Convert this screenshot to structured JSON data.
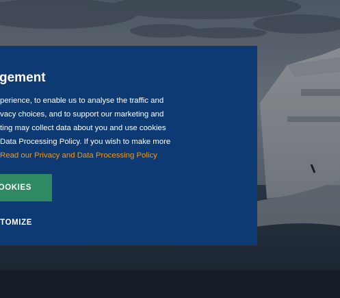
{
  "dialog": {
    "title": "gement",
    "body_lines": [
      "perience, to enable us to analyse the traffic and",
      "vacy choices, and to support our marketing and",
      "ting may collect data about you and use cookies",
      "Data Processing Policy. If you wish to make more"
    ],
    "policy_link_prefix": "R",
    "policy_link": "ead our Privacy and Data Processing Policy",
    "accept_label": "OOKIES",
    "customize_label": "TOMIZE"
  },
  "colors": {
    "dialog_background": "#0d3a72",
    "accept_button": "#2f8a64",
    "link": "#f39a1c"
  }
}
